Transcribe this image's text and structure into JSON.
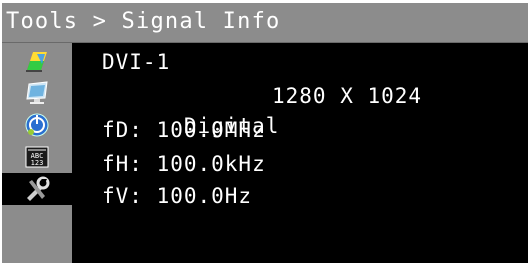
{
  "title": {
    "text": "Tools > Signal Info"
  },
  "sidebar": {
    "items": [
      {
        "icon": "color-adjust-icon",
        "selected": false
      },
      {
        "icon": "screen-adjust-icon",
        "selected": false
      },
      {
        "icon": "power-icon",
        "selected": false
      },
      {
        "icon": "language-abc-123-icon",
        "selected": false
      },
      {
        "icon": "tools-icon",
        "selected": true
      }
    ]
  },
  "signal_info": {
    "input": "DVI-1",
    "signal_type": "Digital",
    "resolution": "1280 X 1024",
    "fD": "fD: 100.0MHz",
    "fH": "fH: 100.0kHz",
    "fV": "fV: 100.0Hz"
  },
  "colors": {
    "background": "#000000",
    "bar_gray": "#8c8c8c",
    "text": "#ffffff"
  }
}
